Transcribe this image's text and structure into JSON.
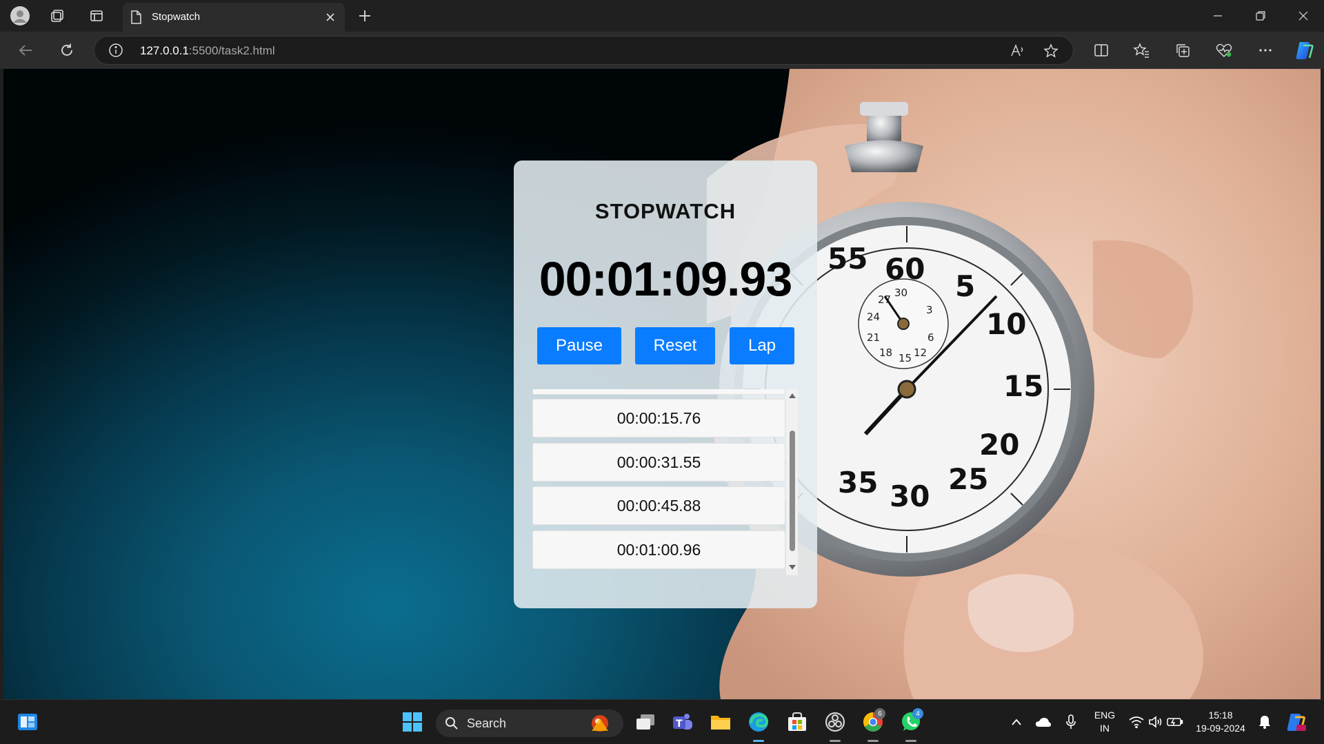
{
  "browser": {
    "tab_title": "Stopwatch",
    "url_host": "127.0.0.1",
    "url_rest": ":5500/task2.html"
  },
  "app": {
    "title": "STOPWATCH",
    "time": "00:01:09.93",
    "buttons": {
      "pause": "Pause",
      "reset": "Reset",
      "lap": "Lap"
    },
    "laps": [
      "00:00:15.76",
      "00:00:31.55",
      "00:00:45.88",
      "00:01:00.96"
    ],
    "accent_color": "#0a7cff"
  },
  "taskbar": {
    "search_label": "Search",
    "language": "ENG",
    "region": "IN",
    "time": "15:18",
    "date": "19-09-2024",
    "badges": {
      "chrome": "6",
      "whatsapp": "4"
    }
  },
  "icons": [
    "profile-icon",
    "workspaces-icon",
    "tab-actions-icon",
    "page-icon",
    "close-icon",
    "plus-icon",
    "minimize-icon",
    "restore-icon",
    "back-icon",
    "refresh-icon",
    "info-icon",
    "read-aloud-icon",
    "favorite-star-icon",
    "split-screen-icon",
    "favorites-icon",
    "collections-icon",
    "browser-essentials-icon",
    "more-icon",
    "copilot-icon",
    "start-icon",
    "search-icon",
    "task-view-icon",
    "teams-icon",
    "file-explorer-icon",
    "edge-icon",
    "store-icon",
    "chrome-icon",
    "whatsapp-icon",
    "wifi-icon",
    "volume-icon",
    "battery-icon",
    "notification-icon"
  ]
}
